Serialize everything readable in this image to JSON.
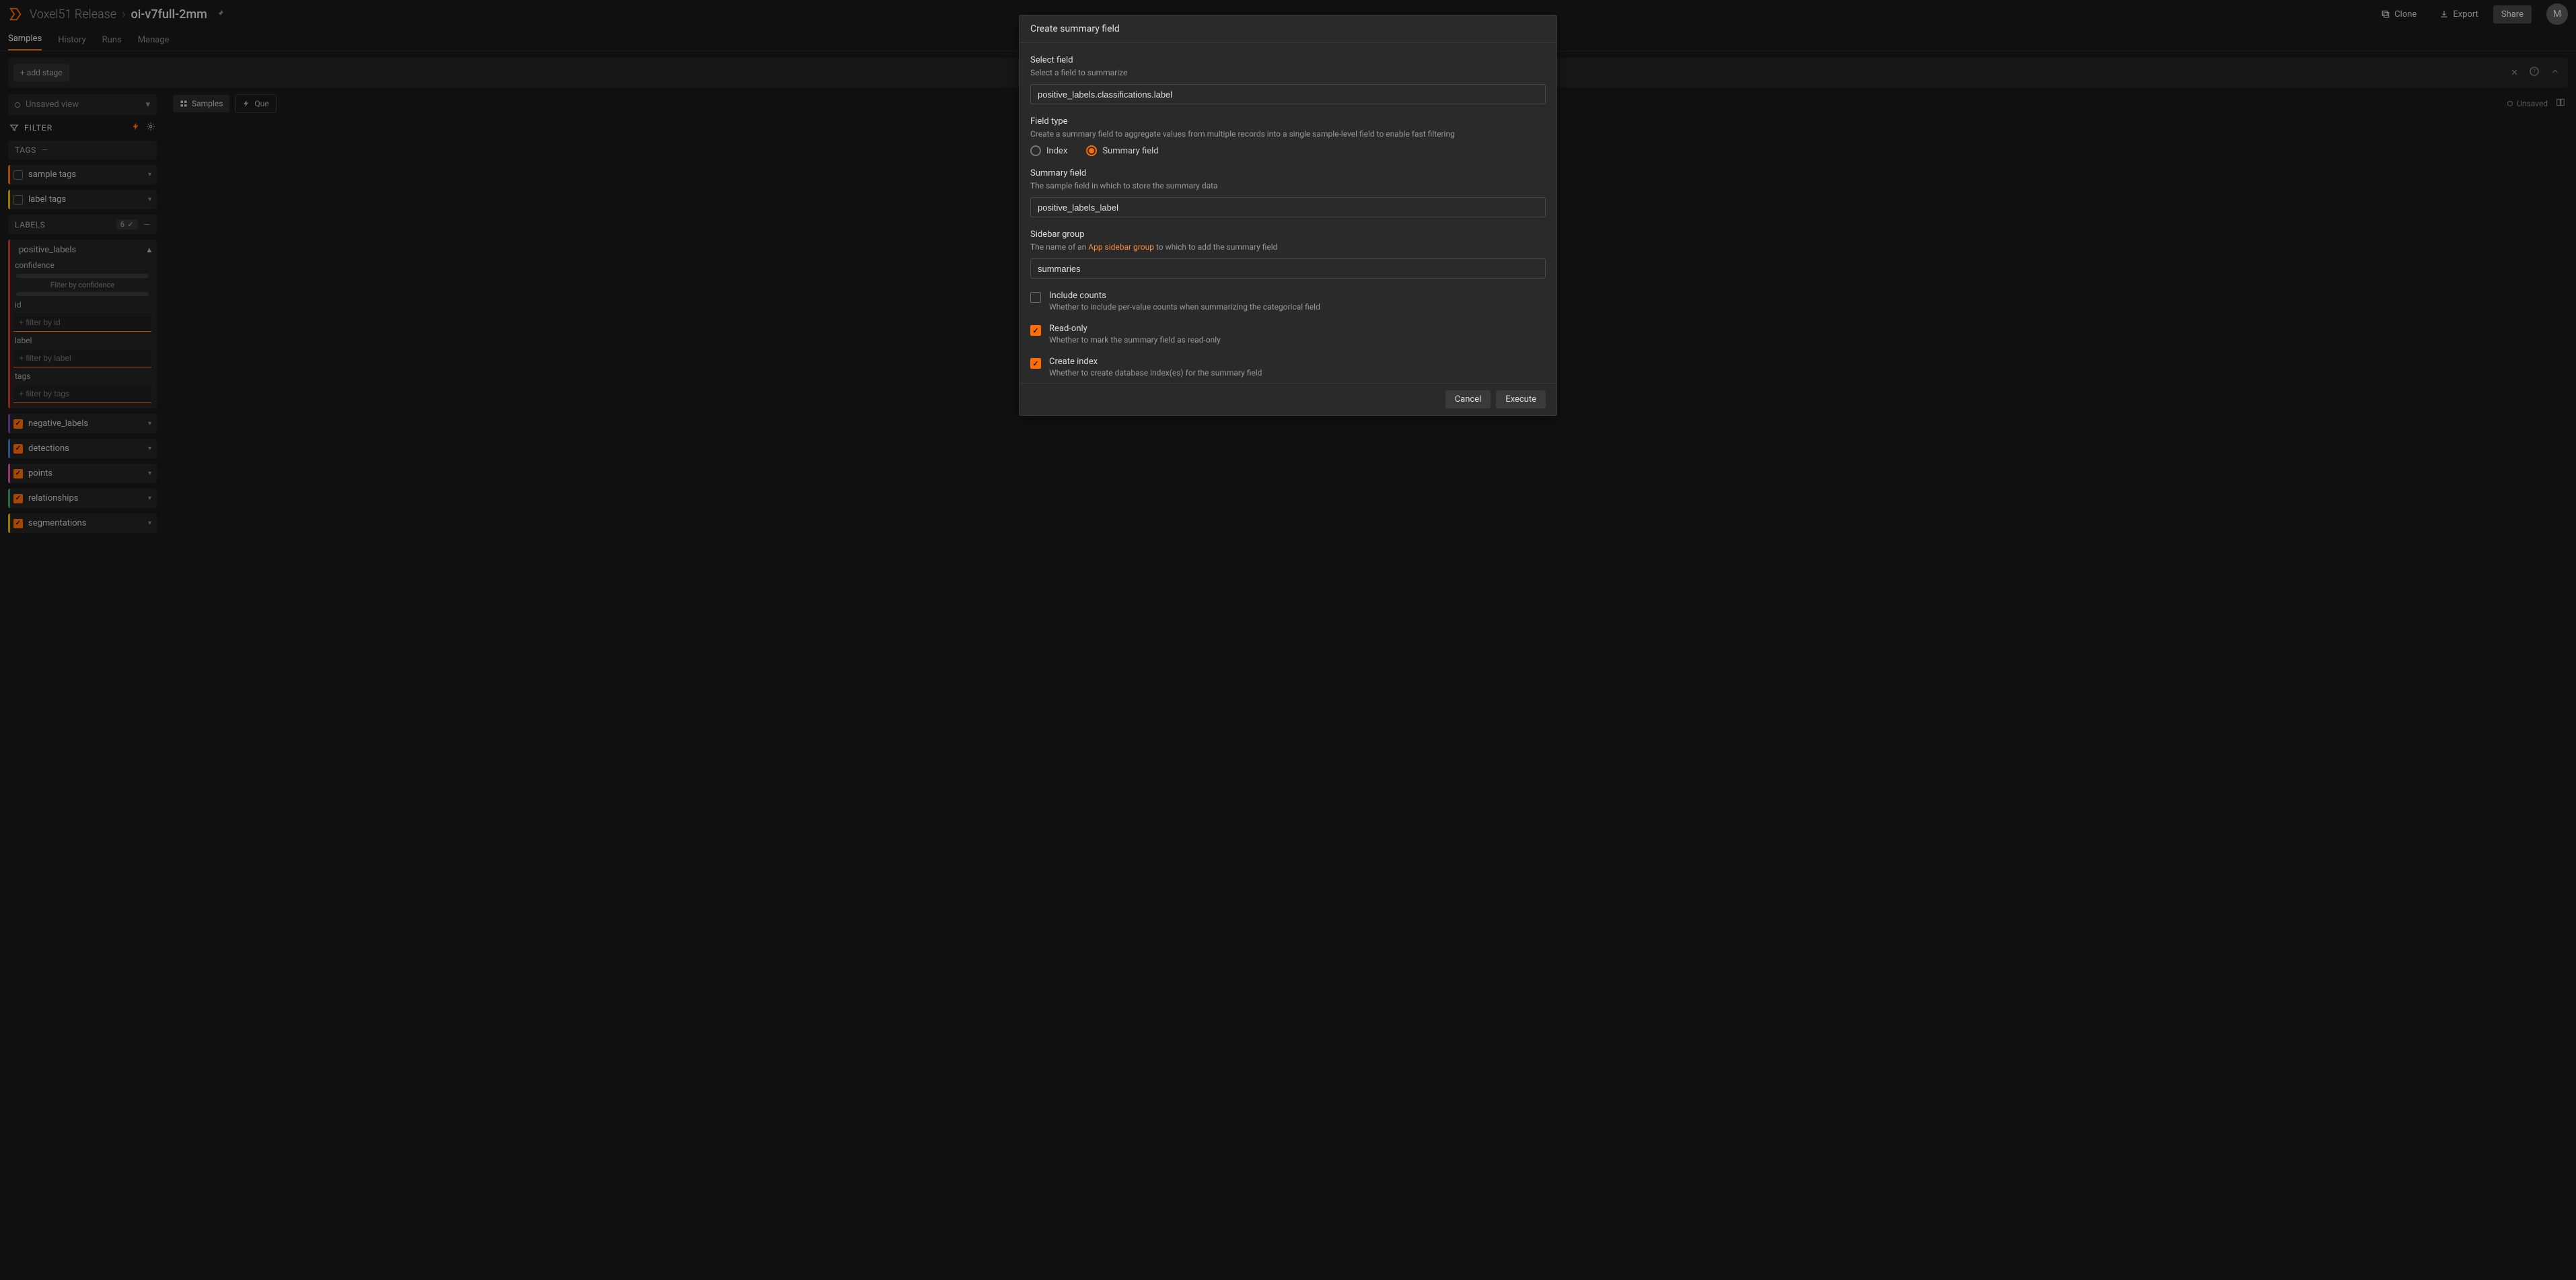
{
  "header": {
    "workspace": "Voxel51 Release",
    "dataset": "oi-v7full-2mm",
    "clone": "Clone",
    "export": "Export",
    "share": "Share",
    "avatar_initial": "M"
  },
  "tabs": {
    "items": [
      "Samples",
      "History",
      "Runs",
      "Manage"
    ],
    "active_index": 0
  },
  "viewbar": {
    "add_stage": "+ add stage"
  },
  "sidebar": {
    "view_select": "Unsaved view",
    "filter_label": "FILTER",
    "tags_header": "TAGS",
    "tag_rows": [
      {
        "label": "sample tags",
        "color": "#ff6d04"
      },
      {
        "label": "label tags",
        "color": "#e8b400"
      }
    ],
    "labels_header": "LABELS",
    "labels_count": "6",
    "positive": {
      "label": "positive_labels",
      "color": "#d43a2f",
      "fields": {
        "confidence": "confidence",
        "confidence_caption": "Filter by confidence",
        "id_label": "id",
        "id_placeholder": "+ filter by id",
        "label_label": "label",
        "label_placeholder": "+ filter by label",
        "tags_label": "tags",
        "tags_placeholder": "+ filter by tags"
      }
    },
    "label_rows": [
      {
        "label": "negative_labels",
        "color": "#7b3fb5"
      },
      {
        "label": "detections",
        "color": "#3a7bd5"
      },
      {
        "label": "points",
        "color": "#e0569b"
      },
      {
        "label": "relationships",
        "color": "#3aa06c"
      },
      {
        "label": "segmentations",
        "color": "#e8b400"
      }
    ]
  },
  "canvas": {
    "tab_samples": "Samples",
    "tab_query": "Que",
    "unsaved": "Unsaved"
  },
  "modal": {
    "title": "Create summary field",
    "select_field": {
      "label": "Select field",
      "help": "Select a field to summarize",
      "value": "positive_labels.classifications.label"
    },
    "field_type": {
      "label": "Field type",
      "help": "Create a summary field to aggregate values from multiple records into a single sample-level field to enable fast filtering",
      "options": [
        {
          "label": "Index",
          "selected": false
        },
        {
          "label": "Summary field",
          "selected": true
        }
      ]
    },
    "summary_field": {
      "label": "Summary field",
      "help": "The sample field in which to store the summary data",
      "value": "positive_labels_label"
    },
    "sidebar_group": {
      "label": "Sidebar group",
      "help_pre": "The name of an ",
      "help_link": "App sidebar group",
      "help_post": " to which to add the summary field",
      "value": "summaries"
    },
    "include_counts": {
      "label": "Include counts",
      "help": "Whether to include per-value counts when summarizing the categorical field",
      "checked": false
    },
    "read_only": {
      "label": "Read-only",
      "help": "Whether to mark the summary field as read-only",
      "checked": true
    },
    "create_index": {
      "label": "Create index",
      "help": "Whether to create database index(es) for the summary field",
      "checked": true
    },
    "cancel": "Cancel",
    "execute": "Execute"
  }
}
